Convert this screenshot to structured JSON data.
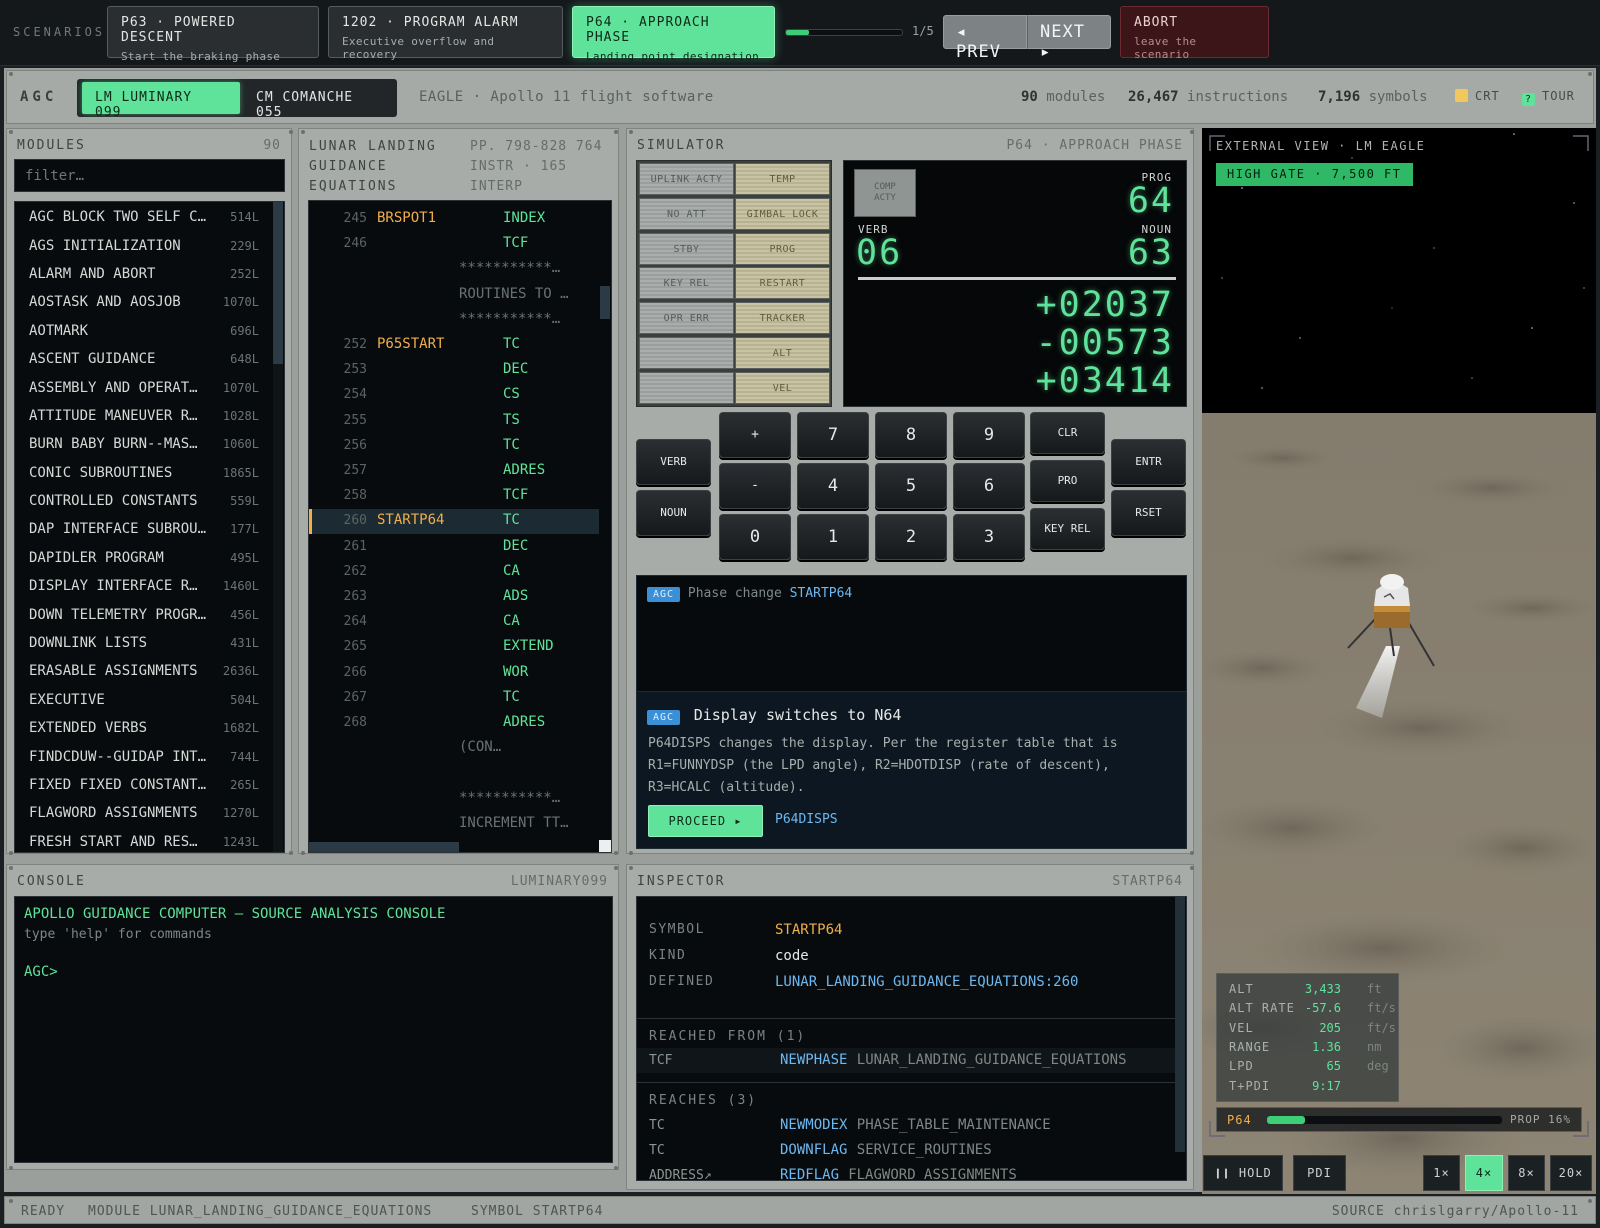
{
  "scenarios": {
    "label": "SCENARIOS",
    "cards": [
      {
        "title": "P63 · POWERED DESCENT",
        "sub": "Start the braking phase"
      },
      {
        "title": "1202 · PROGRAM ALARM",
        "sub": "Executive overflow and recovery"
      },
      {
        "title": "P64 · APPROACH PHASE",
        "sub": "Landing point designation"
      }
    ],
    "progress": 0.2,
    "progress_text": "1/5",
    "prev": "◂ PREV",
    "next": "NEXT ▸",
    "abort": {
      "title": "ABORT",
      "sub": "leave the scenario"
    }
  },
  "header": {
    "agc": "AGC",
    "sw1": "LM LUMINARY 099",
    "sw2": "CM COMANCHE 055",
    "subtitle": "EAGLE · Apollo 11 flight software",
    "modules_n": "90",
    "modules_l": "modules",
    "instr_n": "26,467",
    "instr_l": "instructions",
    "sym_n": "7,196",
    "sym_l": "symbols",
    "crt": "CRT",
    "tour": "TOUR",
    "tour_glyph": "?"
  },
  "modules": {
    "title": "MODULES",
    "count": "90",
    "placeholder": "filter…",
    "items": [
      {
        "name": "AGC BLOCK TWO SELF C…",
        "n": "514L"
      },
      {
        "name": "AGS INITIALIZATION",
        "n": "229L"
      },
      {
        "name": "ALARM AND ABORT",
        "n": "252L"
      },
      {
        "name": "AOSTASK AND AOSJOB",
        "n": "1070L"
      },
      {
        "name": "AOTMARK",
        "n": "696L"
      },
      {
        "name": "ASCENT GUIDANCE",
        "n": "648L"
      },
      {
        "name": "ASSEMBLY AND OPERAT…",
        "n": "1070L"
      },
      {
        "name": "ATTITUDE MANEUVER R…",
        "n": "1028L"
      },
      {
        "name": "BURN BABY BURN--MAS…",
        "n": "1060L"
      },
      {
        "name": "CONIC SUBROUTINES",
        "n": "1865L"
      },
      {
        "name": "CONTROLLED CONSTANTS",
        "n": "559L"
      },
      {
        "name": "DAP INTERFACE SUBROU…",
        "n": "177L"
      },
      {
        "name": "DAPIDLER PROGRAM",
        "n": "495L"
      },
      {
        "name": "DISPLAY INTERFACE R…",
        "n": "1460L"
      },
      {
        "name": "DOWN TELEMETRY PROGR…",
        "n": "456L"
      },
      {
        "name": "DOWNLINK LISTS",
        "n": "431L"
      },
      {
        "name": "ERASABLE ASSIGNMENTS",
        "n": "2636L"
      },
      {
        "name": "EXECUTIVE",
        "n": "504L"
      },
      {
        "name": "EXTENDED VERBS",
        "n": "1682L"
      },
      {
        "name": "FINDCDUW--GUIDAP INT…",
        "n": "744L"
      },
      {
        "name": "FIXED FIXED CONSTANT…",
        "n": "265L"
      },
      {
        "name": "FLAGWORD ASSIGNMENTS",
        "n": "1270L"
      },
      {
        "name": "FRESH START AND RES…",
        "n": "1243L"
      }
    ]
  },
  "code": {
    "title1": "LUNAR LANDING",
    "title2": "GUIDANCE",
    "title3": "EQUATIONS",
    "meta1": "PP. 798-828 764",
    "meta2": "INSTR · 165",
    "meta3": "INTERP",
    "lines": [
      {
        "ln": "245",
        "lbl": "BRSPOT1",
        "op": "INDEX",
        "cm": ""
      },
      {
        "ln": "246",
        "lbl": "",
        "op": "TCF",
        "cm": ""
      },
      {
        "ln": "",
        "lbl": "",
        "op": "",
        "cm": "***********…"
      },
      {
        "ln": "",
        "lbl": "",
        "op": "",
        "cm": "ROUTINES TO …"
      },
      {
        "ln": "",
        "lbl": "",
        "op": "",
        "cm": "***********…"
      },
      {
        "ln": "252",
        "lbl": "P65START",
        "op": "TC",
        "cm": ""
      },
      {
        "ln": "253",
        "lbl": "",
        "op": "DEC",
        "cm": ""
      },
      {
        "ln": "254",
        "lbl": "",
        "op": "CS",
        "cm": ""
      },
      {
        "ln": "255",
        "lbl": "",
        "op": "TS",
        "cm": ""
      },
      {
        "ln": "256",
        "lbl": "",
        "op": "TC",
        "cm": ""
      },
      {
        "ln": "257",
        "lbl": "",
        "op": "ADRES",
        "cm": ""
      },
      {
        "ln": "258",
        "lbl": "",
        "op": "TCF",
        "cm": ""
      },
      {
        "ln": "260",
        "lbl": "STARTP64",
        "op": "TC",
        "cm": ""
      },
      {
        "ln": "261",
        "lbl": "",
        "op": "DEC",
        "cm": ""
      },
      {
        "ln": "262",
        "lbl": "",
        "op": "CA",
        "cm": ""
      },
      {
        "ln": "263",
        "lbl": "",
        "op": "ADS",
        "cm": ""
      },
      {
        "ln": "264",
        "lbl": "",
        "op": "CA",
        "cm": ""
      },
      {
        "ln": "265",
        "lbl": "",
        "op": "EXTEND",
        "cm": ""
      },
      {
        "ln": "266",
        "lbl": "",
        "op": "WOR",
        "cm": ""
      },
      {
        "ln": "267",
        "lbl": "",
        "op": "TC",
        "cm": ""
      },
      {
        "ln": "268",
        "lbl": "",
        "op": "ADRES",
        "cm": ""
      },
      {
        "ln": "",
        "lbl": "",
        "op": "",
        "cm": "    (CON…"
      },
      {
        "ln": "",
        "lbl": "",
        "op": "",
        "cm": ""
      },
      {
        "ln": "",
        "lbl": "",
        "op": "",
        "cm": "***********…"
      },
      {
        "ln": "",
        "lbl": "",
        "op": "",
        "cm": "INCREMENT TT…"
      }
    ]
  },
  "sim": {
    "title": "SIMULATOR",
    "phase": "P64 · APPROACH PHASE",
    "lamps_w": [
      "UPLINK ACTY",
      "NO ATT",
      "STBY",
      "KEY REL",
      "OPR ERR",
      "",
      ""
    ],
    "lamps_y": [
      "TEMP",
      "GIMBAL LOCK",
      "PROG",
      "RESTART",
      "TRACKER",
      "ALT",
      "VEL"
    ],
    "comp1": "COMP",
    "comp2": "ACTY",
    "prog_l": "PROG",
    "prog": "64",
    "verb_l": "VERB",
    "verb": "06",
    "noun_l": "NOUN",
    "noun": "63",
    "r1": "+02037",
    "r2": "-00573",
    "r3": "+03414",
    "keys": {
      "verb": "VERB",
      "noun": "NOUN",
      "plus": "+",
      "minus": "-",
      "k7": "7",
      "k8": "8",
      "k9": "9",
      "k4": "4",
      "k5": "5",
      "k6": "6",
      "k0": "0",
      "k1": "1",
      "k2": "2",
      "k3": "3",
      "clr": "CLR",
      "pro": "PRO",
      "keyrel": "KEY REL",
      "entr": "ENTR",
      "rset": "RSET"
    },
    "log_tag": "AGC",
    "log_text": "Phase change",
    "log_sym": "STARTP64",
    "card_tag": "AGC",
    "card_title": "Display switches to N64",
    "card_body": "P64DISPS changes the display. Per the register table that is R1=FUNNYDSP (the LPD angle), R2=HDOTDISP (rate of descent), R3=HCALC (altitude).",
    "proceed": "PROCEED ▸",
    "proceed_sym": "P64DISPS"
  },
  "ext": {
    "title": "EXTERNAL VIEW · LM EAGLE",
    "badge": "HIGH GATE · 7,500 FT",
    "tele": [
      {
        "k": "ALT",
        "v": "3,433",
        "u": "ft"
      },
      {
        "k": "ALT RATE",
        "v": "-57.6",
        "u": "ft/s"
      },
      {
        "k": "VEL",
        "v": "205",
        "u": "ft/s"
      },
      {
        "k": "RANGE",
        "v": "1.36",
        "u": "nm"
      },
      {
        "k": "LPD",
        "v": "65",
        "u": "deg"
      },
      {
        "k": "T+PDI",
        "v": "9:17",
        "u": ""
      }
    ],
    "prog_l": "P64",
    "prop": "PROP 16%",
    "prop_frac": 0.16,
    "hold": "❙❙ HOLD",
    "pdi": "PDI",
    "speeds": [
      "1×",
      "4×",
      "8×",
      "20×"
    ]
  },
  "console": {
    "title": "CONSOLE",
    "tag": "LUMINARY099",
    "banner": "APOLLO GUIDANCE COMPUTER — SOURCE ANALYSIS CONSOLE",
    "hint": "type 'help' for commands",
    "prompt": "AGC>"
  },
  "inspector": {
    "title": "INSPECTOR",
    "tag": "STARTP64",
    "symbol_k": "SYMBOL",
    "symbol": "STARTP64",
    "kind_k": "KIND",
    "kind": "code",
    "def_k": "DEFINED",
    "def": "LUNAR_LANDING_GUIDANCE_EQUATIONS:260",
    "from_h": "REACHED FROM (1)",
    "from": [
      {
        "op": "TCF",
        "sym": "NEWPHASE",
        "mod": "LUNAR_LANDING_GUIDANCE_EQUATIONS"
      }
    ],
    "reaches_h": "REACHES (3)",
    "reaches": [
      {
        "op": "TC",
        "sym": "NEWMODEX",
        "mod": "PHASE_TABLE_MAINTENANCE"
      },
      {
        "op": "TC",
        "sym": "DOWNFLAG",
        "mod": "SERVICE_ROUTINES"
      },
      {
        "op": "ADDRESS↗",
        "sym": "REDFLAG",
        "mod": "FLAGWORD_ASSIGNMENTS"
      }
    ]
  },
  "status": {
    "ready": "READY",
    "module": "MODULE LUNAR_LANDING_GUIDANCE_EQUATIONS",
    "symbol": "SYMBOL STARTP64",
    "source": "SOURCE chrislgarry/Apollo-11"
  },
  "colors": {
    "accent": "#5fe39a",
    "label": "#f1ae4a",
    "link": "#6db8f0",
    "abort": "#3b1517"
  }
}
